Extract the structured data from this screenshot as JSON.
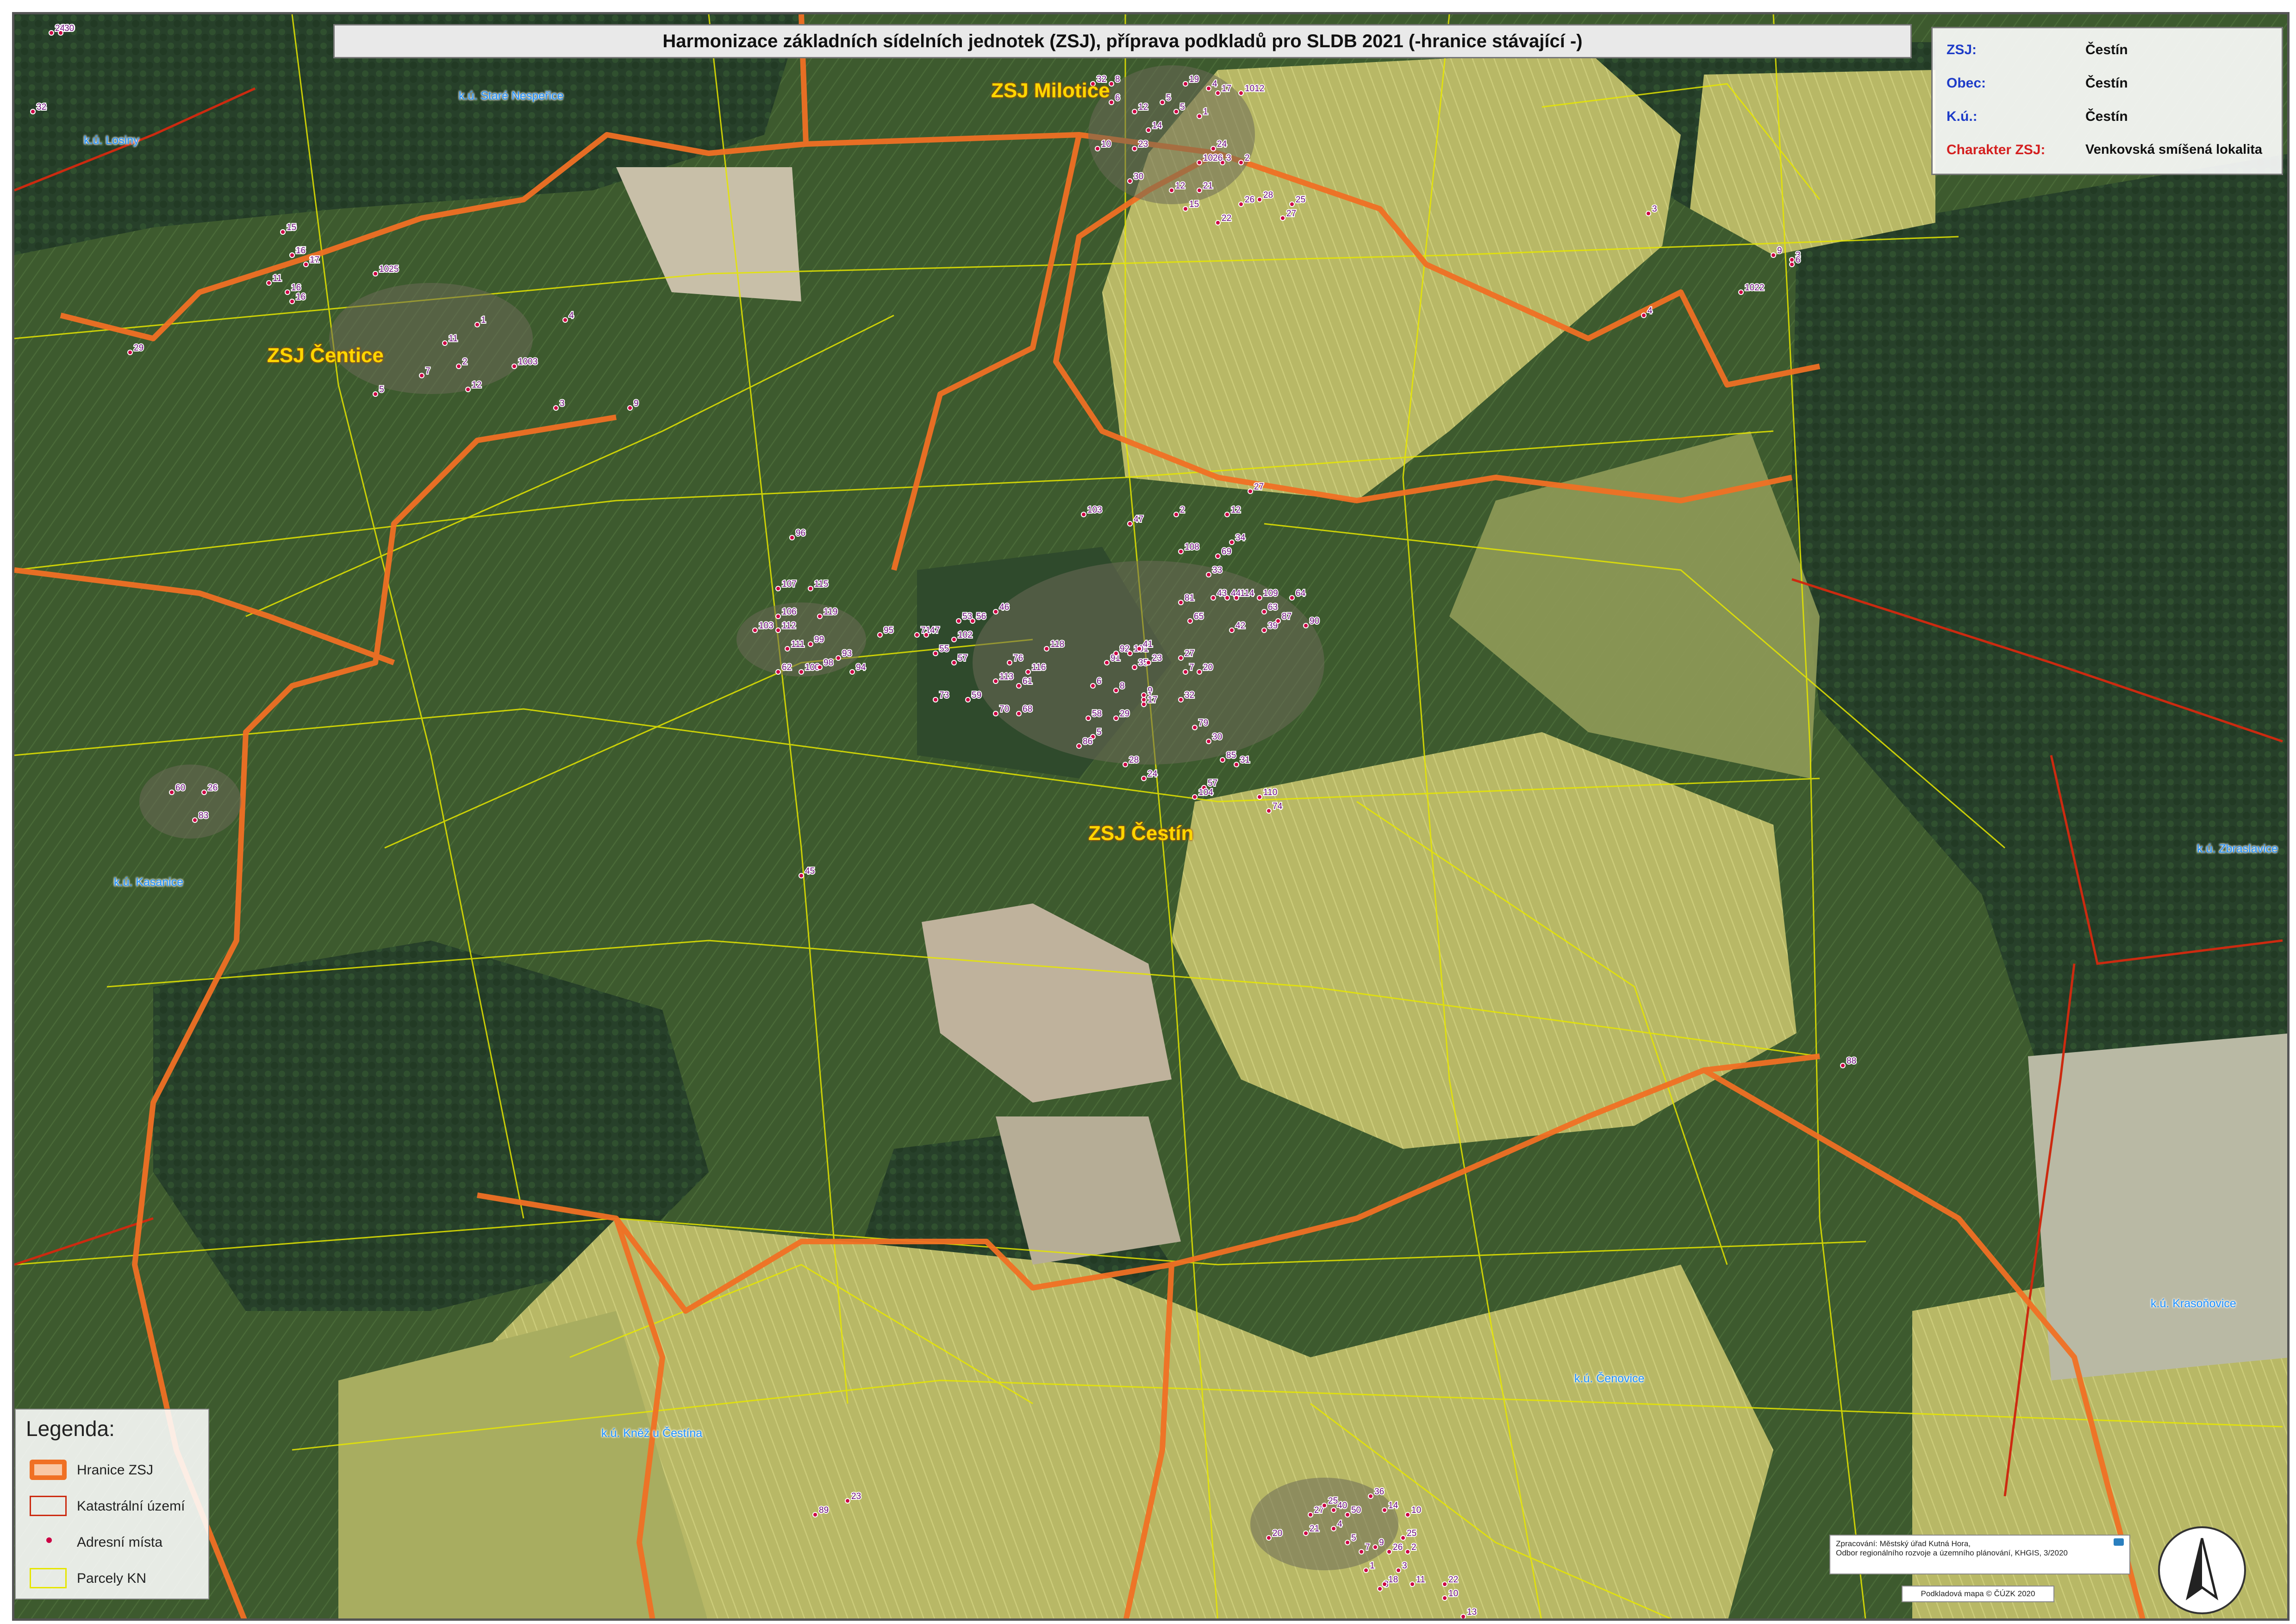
{
  "title": "Harmonizace základních sídelních jednotek (ZSJ), příprava podkladů pro SLDB 2021 (-hranice stávající -)",
  "info": {
    "zsj_key": "ZSJ:",
    "zsj_val": "Čestín",
    "obec_key": "Obec:",
    "obec_val": "Čestín",
    "ku_key": "K.ú.:",
    "ku_val": "Čestín",
    "char_key": "Charakter ZSJ:",
    "char_val": "Venkovská smíšená lokalita",
    "key_color": "#1e3cc8",
    "char_key_color": "#d42020"
  },
  "zsj_labels": {
    "milotice": "ZSJ Milotice",
    "centice": "ZSJ Čentice",
    "cestin": "ZSJ Čestín"
  },
  "ku_labels": {
    "stare_nesperice": "k.ú. Staré Nespeřice",
    "losiny": "k.ú. Losiny",
    "kasanice": "k.ú. Kasanice",
    "zbraslavice": "k.ú. Zbraslavice",
    "krasonovice": "k.ú. Krasoňovice",
    "cenovice": "k.ú. Čenovice",
    "knez_u_cestina": "k.ú. Kněž u Čestína"
  },
  "legend": {
    "title": "Legenda:",
    "items": [
      {
        "label": "Hranice ZSJ",
        "icon": "orange-boundary-line"
      },
      {
        "label": "Katastrální území",
        "icon": "red-outline-box"
      },
      {
        "label": "Adresní místa",
        "icon": "red-dot"
      },
      {
        "label": "Parcely KN",
        "icon": "yellow-parcel-box"
      }
    ]
  },
  "credits": {
    "line1": "Zpracování: Městský úřad Kutná Hora,",
    "line2": "Odbor regionálního rozvoje a územního plánování, KHGIS, 3/2020"
  },
  "basemap": "Podkladová mapa © ČÚZK 2020",
  "colors": {
    "zsj_boundary": "#f07024",
    "ku_boundary": "#cc2a10",
    "parcel": "#e6e600",
    "address_point": "#cc0044",
    "address_label": "#6a0a7a",
    "forest": "#2f4a2a",
    "field_dark": "#3f5a30",
    "field_yellow": "#c8c870",
    "field_bare": "#bdb29a"
  },
  "address_numbers": [
    "1019",
    "19",
    "34",
    "10",
    "37",
    "31",
    "1025",
    "11",
    "16",
    "16",
    "29",
    "1",
    "4",
    "11",
    "7",
    "2",
    "1003",
    "5",
    "12",
    "3",
    "9",
    "32",
    "8",
    "19",
    "4",
    "1012",
    "6",
    "5",
    "12",
    "5",
    "17",
    "1",
    "14",
    "10",
    "23",
    "24",
    "3",
    "1026",
    "2",
    "30",
    "12",
    "21",
    "28",
    "26",
    "25",
    "15",
    "22",
    "27",
    "3",
    "1022",
    "9",
    "3",
    "6",
    "4",
    "103",
    "47",
    "27",
    "12",
    "2",
    "96",
    "107",
    "115",
    "106",
    "119",
    "112",
    "103",
    "99",
    "111",
    "62",
    "100",
    "98",
    "93",
    "94",
    "95",
    "53",
    "56",
    "46",
    "71",
    "47",
    "102",
    "55",
    "57",
    "73",
    "59",
    "76",
    "118",
    "116",
    "113",
    "61",
    "70",
    "68",
    "108",
    "69",
    "34",
    "33",
    "81",
    "43",
    "44",
    "114",
    "109",
    "64",
    "65",
    "63",
    "39",
    "90",
    "87",
    "42",
    "91",
    "92",
    "101",
    "41",
    "35",
    "6",
    "9",
    "8",
    "58",
    "5",
    "1",
    "32",
    "7",
    "20",
    "27",
    "23",
    "17",
    "29",
    "79",
    "30",
    "86",
    "28",
    "24",
    "85",
    "31",
    "57",
    "104",
    "110",
    "74",
    "60",
    "26",
    "83",
    "45",
    "88",
    "89",
    "23",
    "27",
    "25",
    "40",
    "50",
    "36",
    "14",
    "10",
    "20",
    "21",
    "4",
    "5",
    "7",
    "9",
    "26",
    "2",
    "25",
    "1",
    "3",
    "8",
    "18",
    "11",
    "22",
    "10",
    "13",
    "24",
    "30",
    "32",
    "15",
    "16",
    "17"
  ]
}
